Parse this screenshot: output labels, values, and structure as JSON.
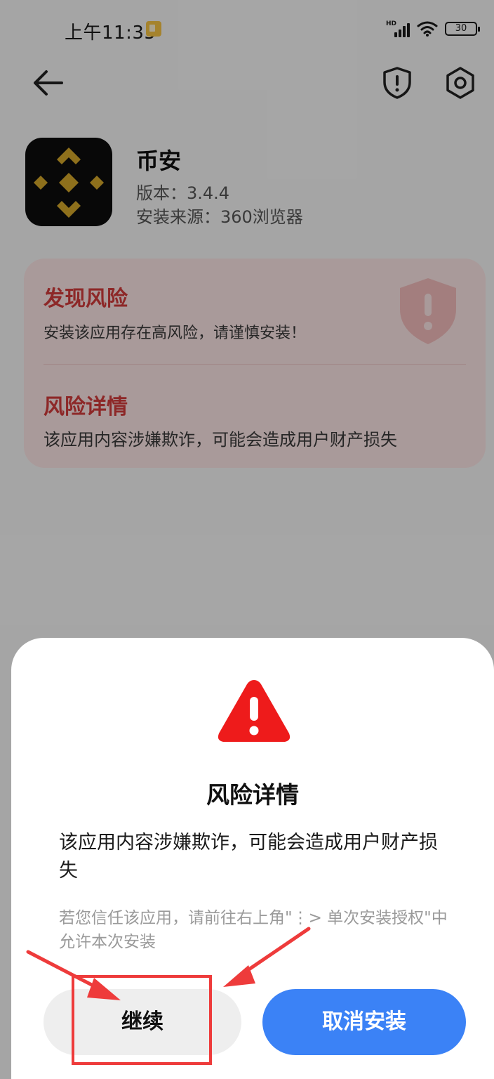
{
  "status_bar": {
    "time": "上午11:35",
    "signal_label": "HD",
    "battery": "30",
    "icons": [
      "notification-icon",
      "signal-icon",
      "wifi-icon",
      "battery-icon"
    ]
  },
  "toolbar": {
    "icons": [
      "back-arrow-icon",
      "shield-alert-icon",
      "settings-icon"
    ]
  },
  "app": {
    "name": "币安",
    "version": "版本：3.4.4",
    "source": "安装来源：360浏览器",
    "icon": "binance-logo-icon"
  },
  "risk_card": {
    "title": "发现风险",
    "text": "安装该应用存在高风险，请谨慎安装！",
    "detail_title": "风险详情",
    "detail_text": "该应用内容涉嫌欺诈，可能会造成用户财产损失"
  },
  "dialog": {
    "title": "风险详情",
    "text": "该应用内容涉嫌欺诈，可能会造成用户财产损失",
    "hint": "若您信任该应用，请前往右上角\"⋮> 单次安装授权\"中允许本次安装",
    "continue_label": "继续",
    "cancel_label": "取消安装",
    "icon": "warning-icon"
  },
  "colors": {
    "risk_red": "#d33d3d",
    "card_bg": "#fde6e6",
    "primary_blue": "#3b82f6",
    "warning_red": "#ee1b1b",
    "binance_gold": "#d4a82a",
    "annotation_red": "#ee3b3b"
  }
}
